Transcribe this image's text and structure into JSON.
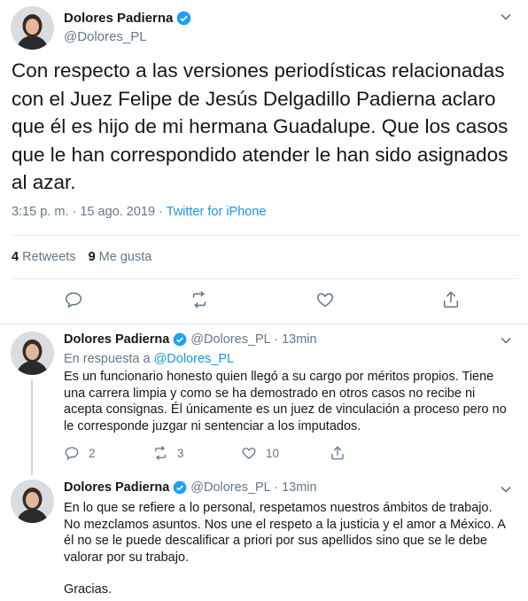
{
  "main_tweet": {
    "name": "Dolores Padierna",
    "handle": "@Dolores_PL",
    "text": "Con respecto a las versiones periodísticas relacionadas con el Juez Felipe de Jesús Delgadillo Padierna aclaro que él es hijo de mi hermana Guadalupe. Que los casos que le han correspondido atender le han sido asignados al azar.",
    "timestamp": "3:15 p. m. · 15 ago. 2019 · ",
    "source": "Twitter for iPhone",
    "retweets_count": "4",
    "retweets_label": "Retweets",
    "likes_count": "9",
    "likes_label": "Me gusta"
  },
  "replies": [
    {
      "name": "Dolores Padierna",
      "handle": "@Dolores_PL · 13min",
      "reply_to_label": "En respuesta a ",
      "reply_to_handle": "@Dolores_PL",
      "text": "Es un funcionario honesto quien llegó a su cargo por méritos propios. Tiene una carrera limpia y como se ha demostrado en otros casos no recibe ni acepta consignas. Él únicamente es un juez de vinculación a  proceso pero no le corresponde juzgar ni sentenciar a los imputados.",
      "reply_count": "2",
      "retweet_count": "3",
      "like_count": "10"
    },
    {
      "name": "Dolores Padierna",
      "handle": "@Dolores_PL · 13min",
      "text": "En lo que se refiere a lo personal, respetamos nuestros ámbitos de trabajo. No mezclamos asuntos.  Nos une el respeto a la justicia y el amor a México. A él no se le puede descalificar a priori por sus apellidos sino que se le debe valorar por su trabajo.",
      "text2": "Gracias."
    }
  ],
  "colors": {
    "verified": "#1da1f2",
    "link": "#1b95e0",
    "muted": "#657786"
  }
}
